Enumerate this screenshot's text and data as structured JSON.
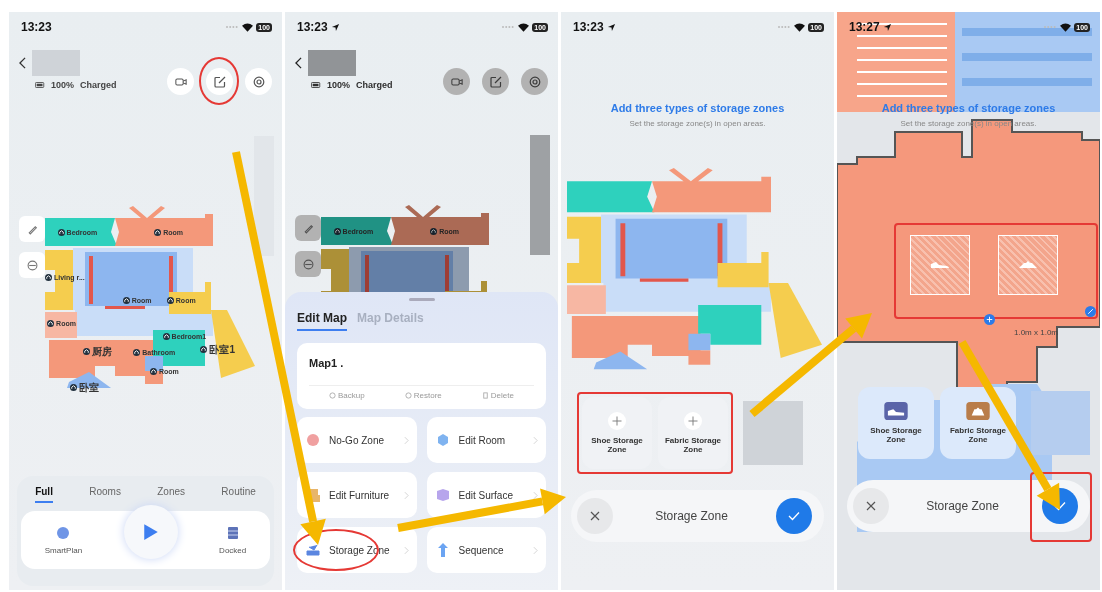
{
  "screens": [
    {
      "kind": "home",
      "status_bar": {
        "time": "13:23",
        "location": false,
        "battery": "100"
      },
      "battery_level": "100%",
      "device_state": "Charged",
      "header_buttons": [
        {
          "kind": "camera",
          "highlighted": false
        },
        {
          "kind": "edit",
          "highlighted": true
        },
        {
          "kind": "settings",
          "highlighted": false
        }
      ],
      "rooms": [
        {
          "label": "Bedroom"
        },
        {
          "label": "Room"
        },
        {
          "label": "Living r..."
        },
        {
          "label": "Room"
        },
        {
          "label": "Room"
        },
        {
          "label": "Room"
        },
        {
          "label": "厨房"
        },
        {
          "label": "Bathroom"
        },
        {
          "label": "Bedroom1"
        },
        {
          "label": "卧室1"
        },
        {
          "label": "Room"
        },
        {
          "label": "卧室"
        }
      ],
      "mode_tabs": [
        {
          "label": "Full",
          "selected": true
        },
        {
          "label": "Rooms",
          "selected": false
        },
        {
          "label": "Zones",
          "selected": false
        },
        {
          "label": "Routine",
          "selected": false
        }
      ],
      "dock_bar": {
        "left_label": "SmartPlan",
        "right_label": "Docked"
      }
    },
    {
      "kind": "edit_sheet",
      "status_bar": {
        "time": "13:23",
        "location": true,
        "battery": "100"
      },
      "battery_level": "100%",
      "device_state": "Charged",
      "header_buttons": [
        {
          "kind": "camera",
          "highlighted": false
        },
        {
          "kind": "edit",
          "highlighted": false
        },
        {
          "kind": "settings",
          "highlighted": false
        }
      ],
      "rooms": [
        {
          "label": "Bedroom"
        },
        {
          "label": "Room"
        }
      ],
      "sheet_tabs": [
        {
          "label": "Edit Map",
          "selected": true
        },
        {
          "label": "Map Details",
          "selected": false
        }
      ],
      "map_name": "Map1 .",
      "map_actions": [
        {
          "kind": "backup",
          "label": "Backup"
        },
        {
          "kind": "restore",
          "label": "Restore"
        },
        {
          "kind": "delete",
          "label": "Delete"
        }
      ],
      "tools": [
        {
          "kind": "no_go",
          "label": "No-Go Zone",
          "highlighted": false
        },
        {
          "kind": "room",
          "label": "Edit Room",
          "highlighted": false
        },
        {
          "kind": "furniture",
          "label": "Edit Furniture",
          "highlighted": false
        },
        {
          "kind": "surface",
          "label": "Edit Surface",
          "highlighted": false
        },
        {
          "kind": "storage",
          "label": "Storage Zone",
          "highlighted": true
        },
        {
          "kind": "sequence",
          "label": "Sequence",
          "highlighted": false
        }
      ]
    },
    {
      "kind": "storage",
      "status_bar": {
        "time": "13:23",
        "location": true,
        "battery": "100"
      },
      "title": "Add three types of storage zones",
      "subtitle": "Set the storage zone(s) in open areas.",
      "zones": [
        {
          "kind": "shoe",
          "label": "Shoe Storage Zone",
          "added": false
        },
        {
          "kind": "fabric",
          "label": "Fabric Storage Zone",
          "added": false
        }
      ],
      "zones_highlighted": true,
      "bar_title": "Storage Zone",
      "confirm_highlighted": false
    },
    {
      "kind": "storage_zoomed",
      "status_bar": {
        "time": "13:27",
        "location": true,
        "battery": "100"
      },
      "title": "Add three types of storage zones",
      "subtitle": "Set the storage zone(s) in open areas.",
      "placed_zones": [
        {
          "kind": "shoe"
        },
        {
          "kind": "fabric"
        }
      ],
      "placed_highlighted": true,
      "dimension": "1.0m x 1.0m",
      "zones": [
        {
          "kind": "shoe",
          "label": "Shoe Storage Zone",
          "added": true
        },
        {
          "kind": "fabric",
          "label": "Fabric Storage Zone",
          "added": true
        }
      ],
      "zones_highlighted": false,
      "bar_title": "Storage Zone",
      "confirm_highlighted": true
    }
  ]
}
